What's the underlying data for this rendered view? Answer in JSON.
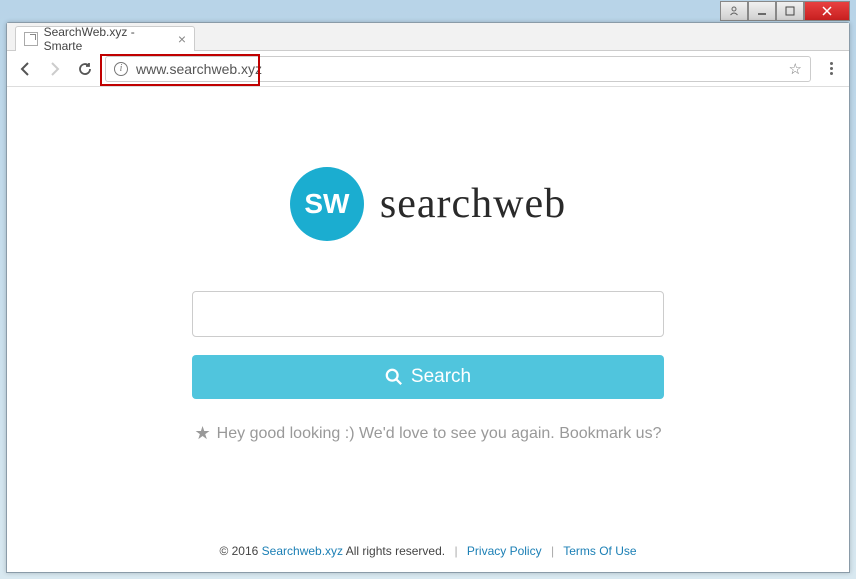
{
  "window": {
    "tab_title": "SearchWeb.xyz - Smarte",
    "url": "www.searchweb.xyz"
  },
  "logo": {
    "badge": "SW",
    "text": "searchweb"
  },
  "search": {
    "input_value": "",
    "button_label": "Search"
  },
  "tagline": "Hey good looking :) We'd love to see you again. Bookmark us?",
  "footer": {
    "copyright_prefix": "© 2016",
    "site_name": "Searchweb.xyz",
    "copyright_suffix": "All rights reserved.",
    "privacy": "Privacy Policy",
    "terms": "Terms Of Use"
  }
}
